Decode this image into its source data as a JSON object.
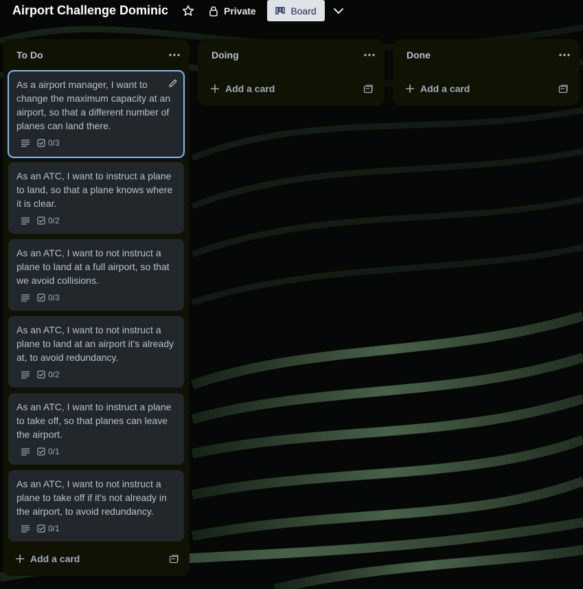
{
  "board": {
    "title": "Airport Challenge Dominic",
    "visibility": "Private",
    "view": "Board"
  },
  "lists": [
    {
      "title": "To Do",
      "add_card": "Add a card",
      "cards": [
        {
          "text": "As a airport manager, I want to change the maximum capacity at an airport, so that a different number of planes can land there.",
          "checklist": "0/3"
        },
        {
          "text": "As an ATC, I want to instruct a plane to land, so that a plane knows where it is clear.",
          "checklist": "0/2"
        },
        {
          "text": "As an ATC, I want to not instruct a plane to land at a full airport, so that we avoid collisions.",
          "checklist": "0/3"
        },
        {
          "text": "As an ATC, I want to not instruct a plane to land at an airport it's already at, to avoid redundancy.",
          "checklist": "0/2"
        },
        {
          "text": "As an ATC, I want to instruct a plane to take off, so that planes can leave the airport.",
          "checklist": "0/1"
        },
        {
          "text": "As an ATC, I want to not instruct a plane to take off if it's not already in the airport, to avoid redundancy.",
          "checklist": "0/1"
        }
      ]
    },
    {
      "title": "Doing",
      "add_card": "Add a card"
    },
    {
      "title": "Done",
      "add_card": "Add a card"
    }
  ],
  "colors": {
    "list_bg": "#101204",
    "card_bg": "#22272b",
    "card_text": "#b6c2cf",
    "selected_outline": "#85b8ff",
    "board_button_bg": "#dfe2e7"
  }
}
